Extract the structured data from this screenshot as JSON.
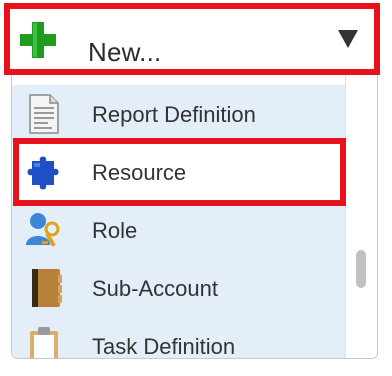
{
  "new_button": {
    "label": "New...",
    "icon": "plus-icon",
    "dropdown_icon": "caret-down-icon"
  },
  "menu": {
    "items": [
      {
        "label": "Report Definition",
        "icon": "report-document-icon"
      },
      {
        "label": "Resource",
        "icon": "puzzle-piece-icon",
        "selected": true
      },
      {
        "label": "Role",
        "icon": "user-key-icon"
      },
      {
        "label": "Sub-Account",
        "icon": "address-book-icon"
      },
      {
        "label": "Task Definition",
        "icon": "clipboard-icon"
      }
    ]
  },
  "colors": {
    "highlight": "#e8121c",
    "menu_item_bg": "#e4eef9",
    "plus_green": "#1f9b1f"
  }
}
